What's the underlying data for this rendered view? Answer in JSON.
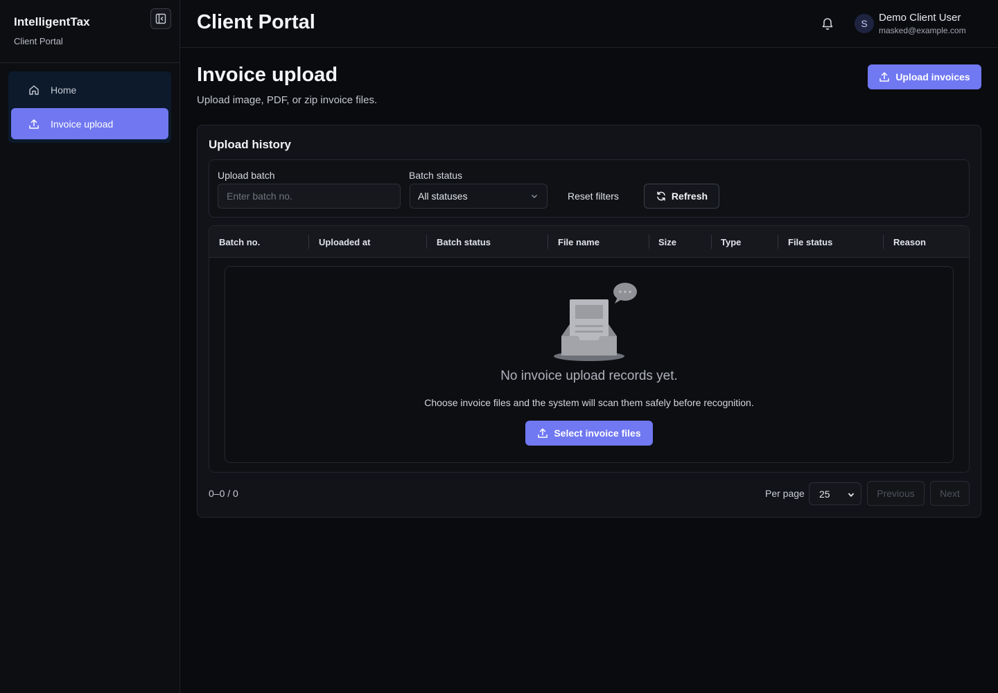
{
  "sidebar": {
    "brand": "IntelligentTax",
    "subtitle": "Client Portal",
    "collapse_icon": "sidebar-collapse-icon",
    "items": [
      {
        "label": "Home",
        "icon": "home-icon",
        "active": false
      },
      {
        "label": "Invoice upload",
        "icon": "upload-icon",
        "active": true
      }
    ]
  },
  "header": {
    "title": "Client Portal",
    "user": {
      "initial": "S",
      "name": "Demo Client User",
      "email": "masked@example.com"
    }
  },
  "page": {
    "title": "Invoice upload",
    "subtitle": "Upload image, PDF, or zip invoice files.",
    "upload_button": "Upload invoices"
  },
  "history": {
    "title": "Upload history",
    "filters": {
      "batch_label": "Upload batch",
      "batch_placeholder": "Enter batch no.",
      "status_label": "Batch status",
      "status_value": "All statuses",
      "reset": "Reset filters",
      "refresh": "Refresh"
    },
    "columns": [
      "Batch no.",
      "Uploaded at",
      "Batch status",
      "File name",
      "Size",
      "Type",
      "File status",
      "Reason"
    ],
    "empty": {
      "title": "No invoice upload records yet.",
      "description": "Choose invoice files and the system will scan them safely before recognition.",
      "button": "Select invoice files"
    },
    "pagination": {
      "range": "0–0 / 0",
      "per_page_label": "Per page",
      "per_page": "25",
      "previous": "Previous",
      "next": "Next"
    }
  },
  "colors": {
    "accent": "#7078f2",
    "background": "#0a0b0e",
    "surface": "#111318"
  }
}
